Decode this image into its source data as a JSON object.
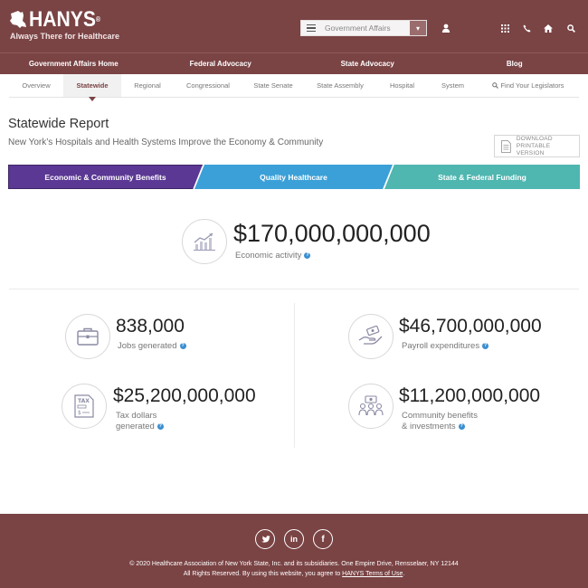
{
  "header": {
    "logo_text": "HANYS",
    "logo_reg": "®",
    "tagline": "Always There for Healthcare",
    "section_selector": {
      "selected": "Government Affairs"
    },
    "icons": [
      "user-icon",
      "grid-icon",
      "phone-icon",
      "home-icon",
      "search-icon"
    ]
  },
  "main_nav": [
    {
      "label": "Government Affairs Home"
    },
    {
      "label": "Federal Advocacy"
    },
    {
      "label": "State Advocacy"
    },
    {
      "label": "Blog"
    }
  ],
  "sub_nav": [
    {
      "label": "Overview"
    },
    {
      "label": "Statewide",
      "active": true
    },
    {
      "label": "Regional"
    },
    {
      "label": "Congressional"
    },
    {
      "label": "State Senate"
    },
    {
      "label": "State Assembly"
    },
    {
      "label": "Hospital"
    },
    {
      "label": "System"
    },
    {
      "label": "Find Your Legislators"
    }
  ],
  "page": {
    "title": "Statewide Report",
    "subtitle": "New York’s Hospitals and Health Systems Improve the Economy & Community",
    "download_line1": "DOWNLOAD",
    "download_line2": "PRINTABLE VERSION"
  },
  "tabs": [
    {
      "label": "Economic & Community Benefits",
      "color": "#5b3894",
      "active": true
    },
    {
      "label": "Quality Healthcare",
      "color": "#3ba0d8"
    },
    {
      "label": "State & Federal Funding",
      "color": "#4fb6b0"
    }
  ],
  "stats": {
    "economic": {
      "value": "$170,000,000,000",
      "label": "Economic activity",
      "icon": "chart-growth-icon"
    },
    "jobs": {
      "value": "838,000",
      "label": "Jobs generated",
      "icon": "briefcase-icon"
    },
    "payroll": {
      "value": "$46,700,000,000",
      "label": "Payroll expenditures",
      "icon": "hand-money-icon"
    },
    "tax": {
      "value": "$25,200,000,000",
      "label_line1": "Tax dollars",
      "label_line2": "generated",
      "icon": "tax-document-icon"
    },
    "community": {
      "value": "$11,200,000,000",
      "label_line1": "Community benefits",
      "label_line2": "& investments",
      "icon": "community-icon"
    },
    "help_symbol": "?"
  },
  "footer": {
    "social": [
      "twitter-icon",
      "linkedin-icon",
      "facebook-icon"
    ],
    "copyright": "© 2020 Healthcare Association of New York State, Inc. and its subsidiaries. One Empire Drive, Rensselaer, NY 12144",
    "rights_prefix": "All Rights Reserved. By using this website, you agree to ",
    "terms_link": "HANYS Terms of Use",
    "rights_suffix": "."
  },
  "colors": {
    "brand": "#7a4344",
    "tab_purple": "#5b3894",
    "tab_blue": "#3ba0d8",
    "tab_teal": "#4fb6b0",
    "help_blue": "#3a8fd0"
  }
}
